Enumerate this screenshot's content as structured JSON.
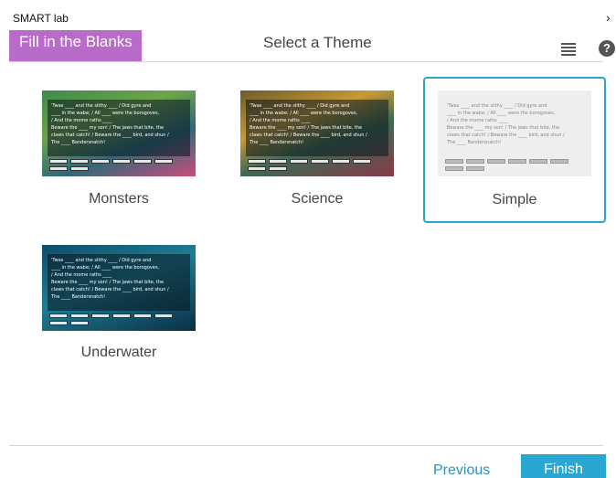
{
  "app": {
    "title": "SMART lab",
    "chevron_glyph": "›"
  },
  "header": {
    "activity_label": "Fill in the Blanks",
    "heading": "Select a Theme",
    "menu_icon": "menu-icon",
    "help_icon_glyph": "?"
  },
  "themes": [
    {
      "name": "Monsters",
      "selected": false
    },
    {
      "name": "Science",
      "selected": false
    },
    {
      "name": "Simple",
      "selected": true
    },
    {
      "name": "Underwater",
      "selected": false
    }
  ],
  "thumbnail_sample": {
    "lines": [
      "'Twas ____ and the slithy ____ / Did gyre and",
      "____ in the wabe; / All ____ were the borogoves,",
      "/ And the mome raths ____",
      "Beware the ____ my son! / The jaws that bite, the",
      "claws that catch! / Beware the ____ bird, and shun /",
      "The ____ Bandersnatch!"
    ]
  },
  "footer": {
    "previous_label": "Previous",
    "finish_label": "Finish"
  },
  "colors": {
    "accent": "#2aa6d2",
    "badge": "#b86bc9",
    "selected_border": "#2ba6c8"
  }
}
